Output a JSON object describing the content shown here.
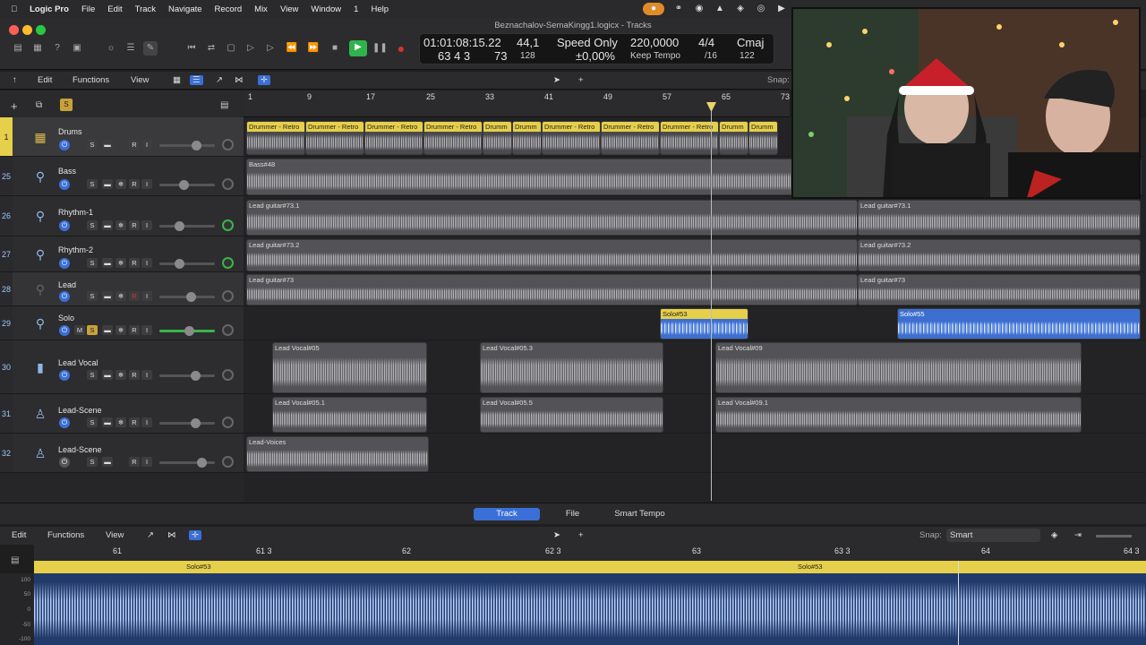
{
  "menubar": {
    "apple": "",
    "app": "Logic Pro",
    "items": [
      "File",
      "Edit",
      "Track",
      "Navigate",
      "Record",
      "Mix",
      "View",
      "Window",
      "1",
      "Help"
    ]
  },
  "window": {
    "title": "Beznachalov-SemaKingg1.logicx - Tracks"
  },
  "lcd": {
    "time": "01:01:08:15.22",
    "bars": "63  4  3",
    "ticks": "73",
    "sample_rate": "44,1",
    "buffer": "128",
    "mode": "Speed Only",
    "pitch": "±0,00%",
    "tempo": "220,0000",
    "tempo_mode": "Keep Tempo",
    "sig": "4/4",
    "div": "/16",
    "key": "Cmaj",
    "bpm2": "122"
  },
  "arrange_toolbar": {
    "edit": "Edit",
    "functions": "Functions",
    "view": "View",
    "snap": "Snap:"
  },
  "ruler": {
    "ticks": [
      "1",
      "9",
      "17",
      "25",
      "33",
      "41",
      "49",
      "57",
      "65",
      "73"
    ]
  },
  "tracks": [
    {
      "num": "1",
      "name": "Drums"
    },
    {
      "num": "25",
      "name": "Bass"
    },
    {
      "num": "26",
      "name": "Rhythm-1"
    },
    {
      "num": "27",
      "name": "Rhythm-2"
    },
    {
      "num": "28",
      "name": "Lead"
    },
    {
      "num": "29",
      "name": "Solo"
    },
    {
      "num": "30",
      "name": "Lead Vocal"
    },
    {
      "num": "31",
      "name": "Lead-Scene"
    },
    {
      "num": "32",
      "name": "Lead-Scene"
    }
  ],
  "regions": {
    "drums": [
      "Drummer - Retro",
      "Drummer - Retro",
      "Drummer - Retro",
      "Drummer - Retro",
      "Drumm",
      "Drumm",
      "Drummer - Retro",
      "Drummer - Retro",
      "Drummer - Retro",
      "Drumm",
      "Drumm"
    ],
    "bass": "Bass#48",
    "rhythm1": [
      "Lead guitar#73.1",
      "Lead guitar#73.1"
    ],
    "rhythm2": [
      "Lead guitar#73.2",
      "Lead guitar#73.2"
    ],
    "lead": [
      "Lead guitar#73",
      "Lead guitar#73"
    ],
    "solo": [
      "Solo#53",
      "Solo#55"
    ],
    "leadvocal": [
      "Lead Vocal#05",
      "Lead Vocal#05.3",
      "Lead Vocal#09"
    ],
    "scene1": [
      "Lead Vocal#05.1",
      "Lead Vocal#05.5",
      "Lead Vocal#09.1"
    ],
    "scene2": "Lead-Voices"
  },
  "editor": {
    "tabs": [
      "Track",
      "File",
      "Smart Tempo"
    ],
    "edit": "Edit",
    "functions": "Functions",
    "view": "View",
    "snap_label": "Snap:",
    "snap_value": "Smart",
    "ruler": [
      "61",
      "61 3",
      "62",
      "62 3",
      "63",
      "63 3",
      "64",
      "64 3"
    ],
    "region_labels": [
      "Solo#53",
      "Solo#53"
    ],
    "scale": [
      "100",
      "50",
      "0",
      "-50",
      "-100"
    ]
  },
  "colors": {
    "accent": "#3a6fd8",
    "region_yellow": "#e6cf4a",
    "play_green": "#2fb34a",
    "record_red": "#d8332e"
  }
}
